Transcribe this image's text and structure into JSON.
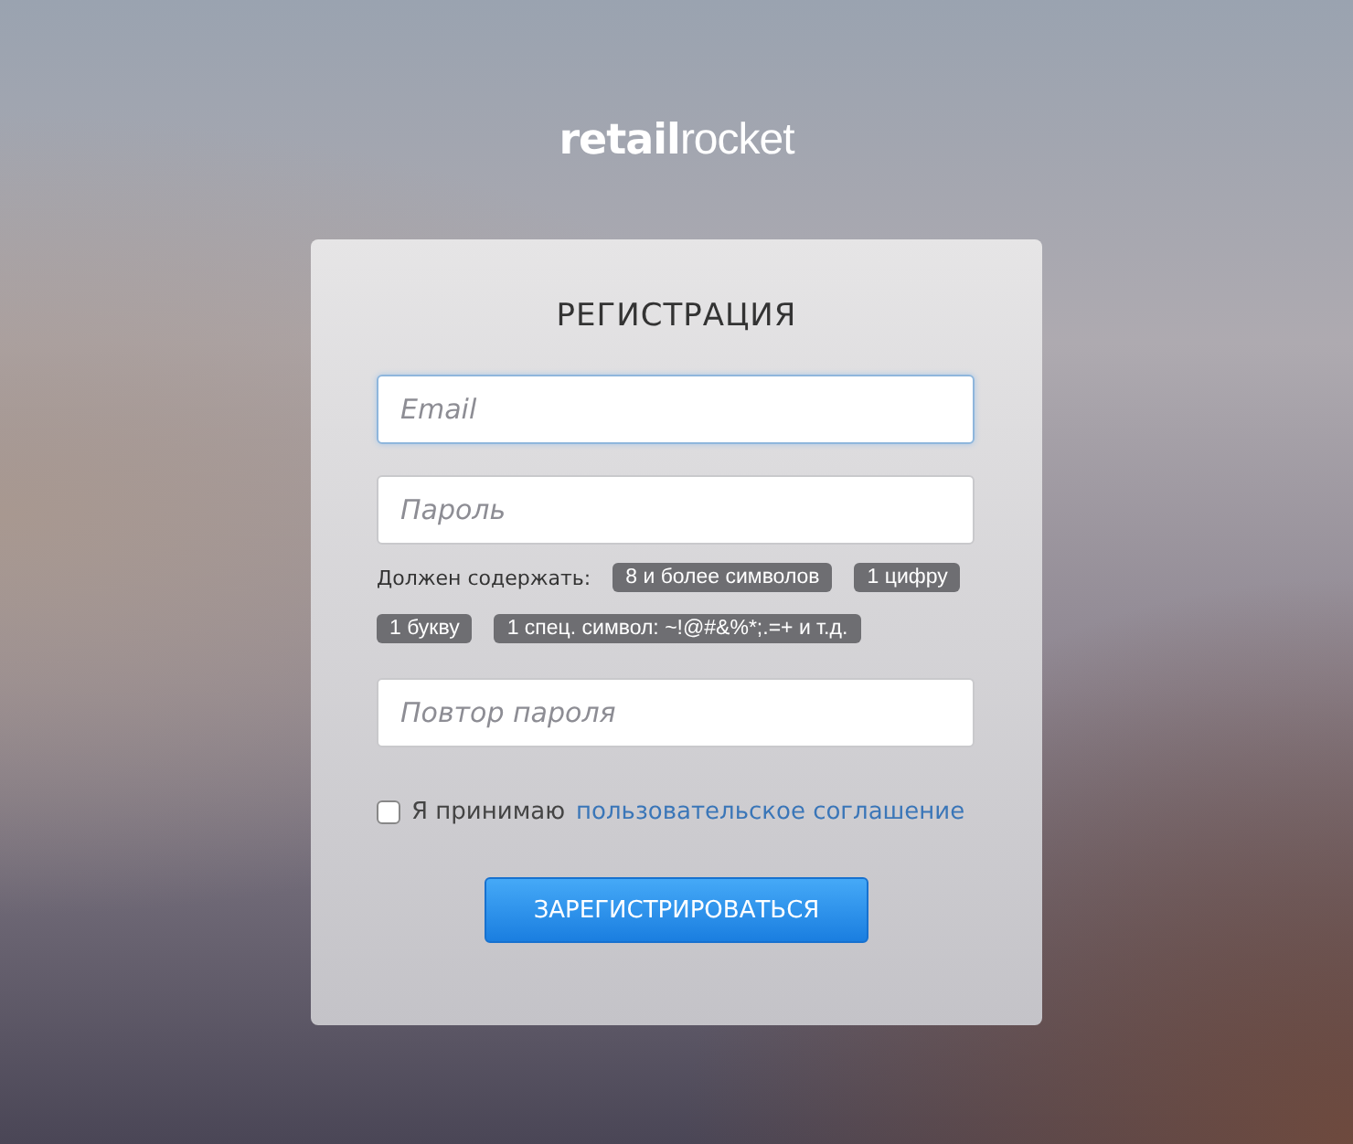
{
  "logo": {
    "bold_part": "retail",
    "light_part": "rocket"
  },
  "form": {
    "title": "РЕГИСТРАЦИЯ",
    "fields": [
      {
        "placeholder": "Email",
        "focused": true
      },
      {
        "placeholder": "Пароль",
        "focused": false
      }
    ],
    "requirements": {
      "label": "Должен содержать:",
      "badges": [
        "8 и более символов",
        "1 цифру",
        "1 букву",
        "1 спец. символ: ~!@#&%*;.=+ и т.д."
      ]
    },
    "repeat_field": {
      "placeholder": "Повтор пароля",
      "focused": false
    },
    "agreement": {
      "checked": false,
      "text": "Я принимаю",
      "link": "пользовательское соглашение"
    },
    "submit": "ЗАРЕГИСТРИРОВАТЬСЯ"
  }
}
